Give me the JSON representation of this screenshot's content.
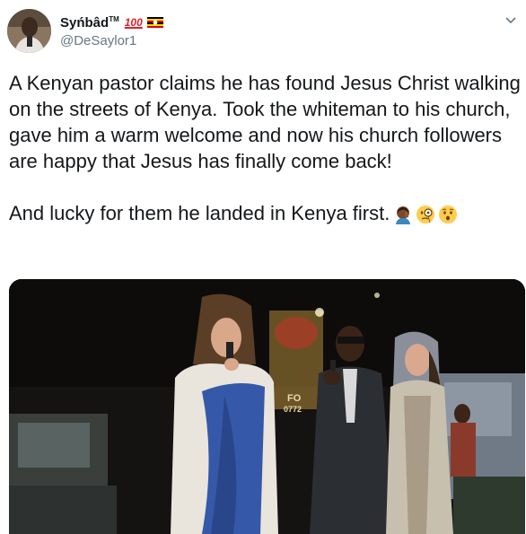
{
  "author": {
    "display_name": "Syńbâd",
    "tm": "TM",
    "badge": "100",
    "handle": "@DeSaylor1"
  },
  "tweet": {
    "paragraph1": "A Kenyan pastor claims he has found Jesus Christ walking on the streets of Kenya. Took the whiteman to his church, gave him a warm welcome and now his church followers are happy that Jesus has finally come back!",
    "paragraph2": "And lucky for them he landed in Kenya first."
  },
  "emojis": [
    "man-facepalming-icon",
    "face-with-monocle-icon",
    "hushed-face-icon"
  ],
  "photo_sign": {
    "line1": "FO",
    "line2": "0772"
  },
  "colors": {
    "text": "#14171a",
    "secondary": "#657786",
    "badge_red": "#e0202b"
  }
}
